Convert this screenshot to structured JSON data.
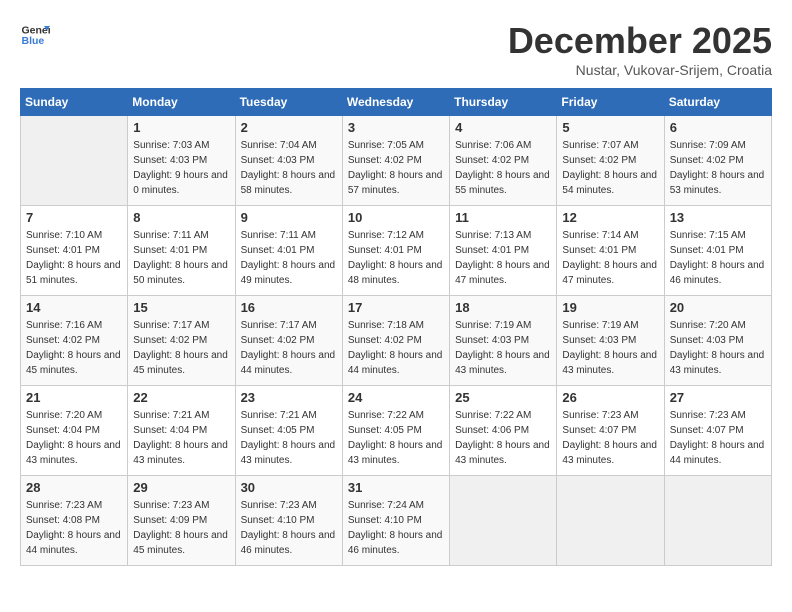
{
  "header": {
    "logo": {
      "general": "General",
      "blue": "Blue"
    },
    "title": "December 2025",
    "location": "Nustar, Vukovar-Srijem, Croatia"
  },
  "calendar": {
    "days_of_week": [
      "Sunday",
      "Monday",
      "Tuesday",
      "Wednesday",
      "Thursday",
      "Friday",
      "Saturday"
    ],
    "weeks": [
      [
        {
          "day": "",
          "sunrise": "",
          "sunset": "",
          "daylight": "",
          "empty": true
        },
        {
          "day": "1",
          "sunrise": "Sunrise: 7:03 AM",
          "sunset": "Sunset: 4:03 PM",
          "daylight": "Daylight: 9 hours and 0 minutes.",
          "empty": false
        },
        {
          "day": "2",
          "sunrise": "Sunrise: 7:04 AM",
          "sunset": "Sunset: 4:03 PM",
          "daylight": "Daylight: 8 hours and 58 minutes.",
          "empty": false
        },
        {
          "day": "3",
          "sunrise": "Sunrise: 7:05 AM",
          "sunset": "Sunset: 4:02 PM",
          "daylight": "Daylight: 8 hours and 57 minutes.",
          "empty": false
        },
        {
          "day": "4",
          "sunrise": "Sunrise: 7:06 AM",
          "sunset": "Sunset: 4:02 PM",
          "daylight": "Daylight: 8 hours and 55 minutes.",
          "empty": false
        },
        {
          "day": "5",
          "sunrise": "Sunrise: 7:07 AM",
          "sunset": "Sunset: 4:02 PM",
          "daylight": "Daylight: 8 hours and 54 minutes.",
          "empty": false
        },
        {
          "day": "6",
          "sunrise": "Sunrise: 7:09 AM",
          "sunset": "Sunset: 4:02 PM",
          "daylight": "Daylight: 8 hours and 53 minutes.",
          "empty": false
        }
      ],
      [
        {
          "day": "7",
          "sunrise": "Sunrise: 7:10 AM",
          "sunset": "Sunset: 4:01 PM",
          "daylight": "Daylight: 8 hours and 51 minutes.",
          "empty": false
        },
        {
          "day": "8",
          "sunrise": "Sunrise: 7:11 AM",
          "sunset": "Sunset: 4:01 PM",
          "daylight": "Daylight: 8 hours and 50 minutes.",
          "empty": false
        },
        {
          "day": "9",
          "sunrise": "Sunrise: 7:11 AM",
          "sunset": "Sunset: 4:01 PM",
          "daylight": "Daylight: 8 hours and 49 minutes.",
          "empty": false
        },
        {
          "day": "10",
          "sunrise": "Sunrise: 7:12 AM",
          "sunset": "Sunset: 4:01 PM",
          "daylight": "Daylight: 8 hours and 48 minutes.",
          "empty": false
        },
        {
          "day": "11",
          "sunrise": "Sunrise: 7:13 AM",
          "sunset": "Sunset: 4:01 PM",
          "daylight": "Daylight: 8 hours and 47 minutes.",
          "empty": false
        },
        {
          "day": "12",
          "sunrise": "Sunrise: 7:14 AM",
          "sunset": "Sunset: 4:01 PM",
          "daylight": "Daylight: 8 hours and 47 minutes.",
          "empty": false
        },
        {
          "day": "13",
          "sunrise": "Sunrise: 7:15 AM",
          "sunset": "Sunset: 4:01 PM",
          "daylight": "Daylight: 8 hours and 46 minutes.",
          "empty": false
        }
      ],
      [
        {
          "day": "14",
          "sunrise": "Sunrise: 7:16 AM",
          "sunset": "Sunset: 4:02 PM",
          "daylight": "Daylight: 8 hours and 45 minutes.",
          "empty": false
        },
        {
          "day": "15",
          "sunrise": "Sunrise: 7:17 AM",
          "sunset": "Sunset: 4:02 PM",
          "daylight": "Daylight: 8 hours and 45 minutes.",
          "empty": false
        },
        {
          "day": "16",
          "sunrise": "Sunrise: 7:17 AM",
          "sunset": "Sunset: 4:02 PM",
          "daylight": "Daylight: 8 hours and 44 minutes.",
          "empty": false
        },
        {
          "day": "17",
          "sunrise": "Sunrise: 7:18 AM",
          "sunset": "Sunset: 4:02 PM",
          "daylight": "Daylight: 8 hours and 44 minutes.",
          "empty": false
        },
        {
          "day": "18",
          "sunrise": "Sunrise: 7:19 AM",
          "sunset": "Sunset: 4:03 PM",
          "daylight": "Daylight: 8 hours and 43 minutes.",
          "empty": false
        },
        {
          "day": "19",
          "sunrise": "Sunrise: 7:19 AM",
          "sunset": "Sunset: 4:03 PM",
          "daylight": "Daylight: 8 hours and 43 minutes.",
          "empty": false
        },
        {
          "day": "20",
          "sunrise": "Sunrise: 7:20 AM",
          "sunset": "Sunset: 4:03 PM",
          "daylight": "Daylight: 8 hours and 43 minutes.",
          "empty": false
        }
      ],
      [
        {
          "day": "21",
          "sunrise": "Sunrise: 7:20 AM",
          "sunset": "Sunset: 4:04 PM",
          "daylight": "Daylight: 8 hours and 43 minutes.",
          "empty": false
        },
        {
          "day": "22",
          "sunrise": "Sunrise: 7:21 AM",
          "sunset": "Sunset: 4:04 PM",
          "daylight": "Daylight: 8 hours and 43 minutes.",
          "empty": false
        },
        {
          "day": "23",
          "sunrise": "Sunrise: 7:21 AM",
          "sunset": "Sunset: 4:05 PM",
          "daylight": "Daylight: 8 hours and 43 minutes.",
          "empty": false
        },
        {
          "day": "24",
          "sunrise": "Sunrise: 7:22 AM",
          "sunset": "Sunset: 4:05 PM",
          "daylight": "Daylight: 8 hours and 43 minutes.",
          "empty": false
        },
        {
          "day": "25",
          "sunrise": "Sunrise: 7:22 AM",
          "sunset": "Sunset: 4:06 PM",
          "daylight": "Daylight: 8 hours and 43 minutes.",
          "empty": false
        },
        {
          "day": "26",
          "sunrise": "Sunrise: 7:23 AM",
          "sunset": "Sunset: 4:07 PM",
          "daylight": "Daylight: 8 hours and 43 minutes.",
          "empty": false
        },
        {
          "day": "27",
          "sunrise": "Sunrise: 7:23 AM",
          "sunset": "Sunset: 4:07 PM",
          "daylight": "Daylight: 8 hours and 44 minutes.",
          "empty": false
        }
      ],
      [
        {
          "day": "28",
          "sunrise": "Sunrise: 7:23 AM",
          "sunset": "Sunset: 4:08 PM",
          "daylight": "Daylight: 8 hours and 44 minutes.",
          "empty": false
        },
        {
          "day": "29",
          "sunrise": "Sunrise: 7:23 AM",
          "sunset": "Sunset: 4:09 PM",
          "daylight": "Daylight: 8 hours and 45 minutes.",
          "empty": false
        },
        {
          "day": "30",
          "sunrise": "Sunrise: 7:23 AM",
          "sunset": "Sunset: 4:10 PM",
          "daylight": "Daylight: 8 hours and 46 minutes.",
          "empty": false
        },
        {
          "day": "31",
          "sunrise": "Sunrise: 7:24 AM",
          "sunset": "Sunset: 4:10 PM",
          "daylight": "Daylight: 8 hours and 46 minutes.",
          "empty": false
        },
        {
          "day": "",
          "sunrise": "",
          "sunset": "",
          "daylight": "",
          "empty": true
        },
        {
          "day": "",
          "sunrise": "",
          "sunset": "",
          "daylight": "",
          "empty": true
        },
        {
          "day": "",
          "sunrise": "",
          "sunset": "",
          "daylight": "",
          "empty": true
        }
      ]
    ]
  }
}
